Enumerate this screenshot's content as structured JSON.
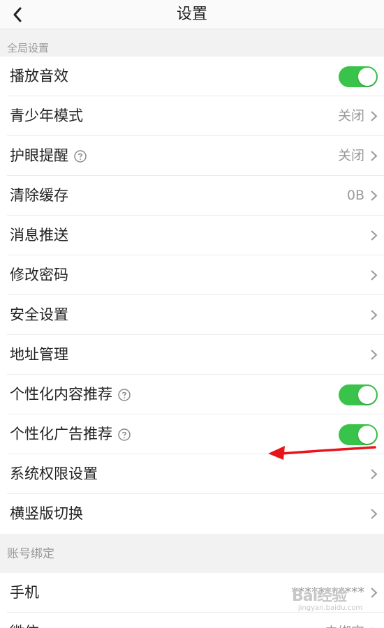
{
  "header": {
    "title": "设置"
  },
  "sections": {
    "global": "全局设置",
    "account": "账号绑定"
  },
  "rows": {
    "sound": {
      "label": "播放音效",
      "toggle_on": true
    },
    "youth_mode": {
      "label": "青少年模式",
      "value": "关闭"
    },
    "eye_care": {
      "label": "护眼提醒",
      "value": "关闭"
    },
    "clear_cache": {
      "label": "清除缓存",
      "value": "0B"
    },
    "push": {
      "label": "消息推送"
    },
    "change_password": {
      "label": "修改密码"
    },
    "security": {
      "label": "安全设置"
    },
    "address": {
      "label": "地址管理"
    },
    "personalized_content": {
      "label": "个性化内容推荐",
      "toggle_on": true
    },
    "personalized_ads": {
      "label": "个性化广告推荐",
      "toggle_on": true
    },
    "system_permissions": {
      "label": "系统权限设置"
    },
    "orientation": {
      "label": "横竖版切换"
    },
    "phone": {
      "label": "手机",
      "value": "***********"
    },
    "wechat": {
      "label": "微信",
      "value": "去绑定"
    }
  },
  "watermark": {
    "main": "Bai经验",
    "sub": "jingyan.baidu.com"
  },
  "colors": {
    "toggle_on": "#3ac34b",
    "arrow": "#e8141c",
    "muted_text": "#999999"
  },
  "icons": {
    "back": "chevron-left-icon",
    "chevron": "chevron-right-icon",
    "help": "question-circle-icon"
  }
}
